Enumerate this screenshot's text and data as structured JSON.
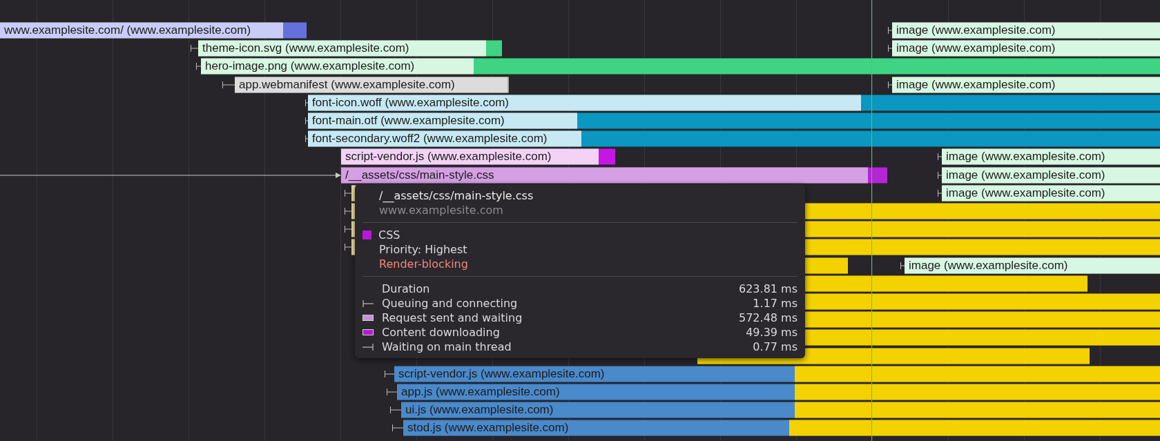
{
  "waterfall": {
    "rows": [
      {
        "bars": [
          {
            "kind": "document",
            "label": "www.examplesite.com/ (www.examplesite.com)"
          },
          {
            "kind": "image",
            "label": "image (www.examplesite.com)"
          }
        ]
      },
      {
        "bars": [
          {
            "kind": "image",
            "label": "theme-icon.svg (www.examplesite.com)"
          },
          {
            "kind": "image",
            "label": "image (www.examplesite.com)"
          }
        ]
      },
      {
        "bars": [
          {
            "kind": "image",
            "label": "hero-image.png (www.examplesite.com)"
          }
        ]
      },
      {
        "bars": [
          {
            "kind": "manifest",
            "label": "app.webmanifest (www.examplesite.com)"
          },
          {
            "kind": "image",
            "label": "image (www.examplesite.com)"
          }
        ]
      },
      {
        "bars": [
          {
            "kind": "font",
            "label": "font-icon.woff (www.examplesite.com)"
          }
        ]
      },
      {
        "bars": [
          {
            "kind": "font",
            "label": "font-main.otf (www.examplesite.com)"
          }
        ]
      },
      {
        "bars": [
          {
            "kind": "font",
            "label": "font-secondary.woff2 (www.examplesite.com)"
          }
        ]
      },
      {
        "bars": [
          {
            "kind": "preload",
            "label": "script-vendor.js (www.examplesite.com)"
          },
          {
            "kind": "image",
            "label": "image (www.examplesite.com)"
          }
        ]
      },
      {
        "bars": [
          {
            "kind": "stylesheet",
            "label": "/__assets/css/main-style.css"
          },
          {
            "kind": "image",
            "label": "image (www.examplesite.com)"
          }
        ]
      },
      {
        "bars": [
          {
            "kind": "script"
          },
          {
            "kind": "image",
            "label": "image (www.examplesite.com)"
          }
        ]
      },
      {
        "bars": [
          {
            "kind": "script"
          },
          {
            "kind": "script"
          }
        ]
      },
      {
        "bars": [
          {
            "kind": "script"
          },
          {
            "kind": "script"
          }
        ]
      },
      {
        "bars": [
          {
            "kind": "script"
          },
          {
            "kind": "script"
          }
        ]
      },
      {
        "bars": [
          {
            "kind": "script"
          },
          {
            "kind": "image",
            "label": "image (www.examplesite.com)"
          }
        ]
      },
      {
        "bars": [
          {
            "kind": "script"
          }
        ]
      },
      {
        "bars": [
          {
            "kind": "script"
          }
        ]
      },
      {
        "bars": [
          {
            "kind": "script"
          }
        ]
      },
      {
        "bars": [
          {
            "kind": "script"
          }
        ]
      },
      {
        "bars": [
          {
            "kind": "script"
          }
        ]
      },
      {
        "bars": [
          {
            "kind": "fetch",
            "label": "script-vendor.js (www.examplesite.com)"
          },
          {
            "kind": "script"
          }
        ]
      },
      {
        "bars": [
          {
            "kind": "fetch",
            "label": "app.js (www.examplesite.com)"
          },
          {
            "kind": "script"
          }
        ]
      },
      {
        "bars": [
          {
            "kind": "fetch",
            "label": "ui.js (www.examplesite.com)"
          },
          {
            "kind": "script"
          }
        ]
      },
      {
        "bars": [
          {
            "kind": "fetch",
            "label": "stod.js (www.examplesite.com)"
          },
          {
            "kind": "script"
          }
        ]
      }
    ]
  },
  "tooltip": {
    "title": "/__assets/css/main-style.css",
    "host": "www.examplesite.com",
    "resource_type": "CSS",
    "priority": "Priority: Highest",
    "render_blocking": "Render-blocking",
    "timings": [
      {
        "kind": "total",
        "label": "Duration",
        "value": "623.81 ms"
      },
      {
        "kind": "queuing",
        "label": "Queuing and connecting",
        "value": "1.17 ms"
      },
      {
        "kind": "request",
        "label": "Request sent and waiting",
        "value": "572.48 ms"
      },
      {
        "kind": "download",
        "label": "Content downloading",
        "value": "49.39 ms"
      },
      {
        "kind": "waiting",
        "label": "Waiting on main thread",
        "value": "0.77 ms"
      }
    ]
  }
}
